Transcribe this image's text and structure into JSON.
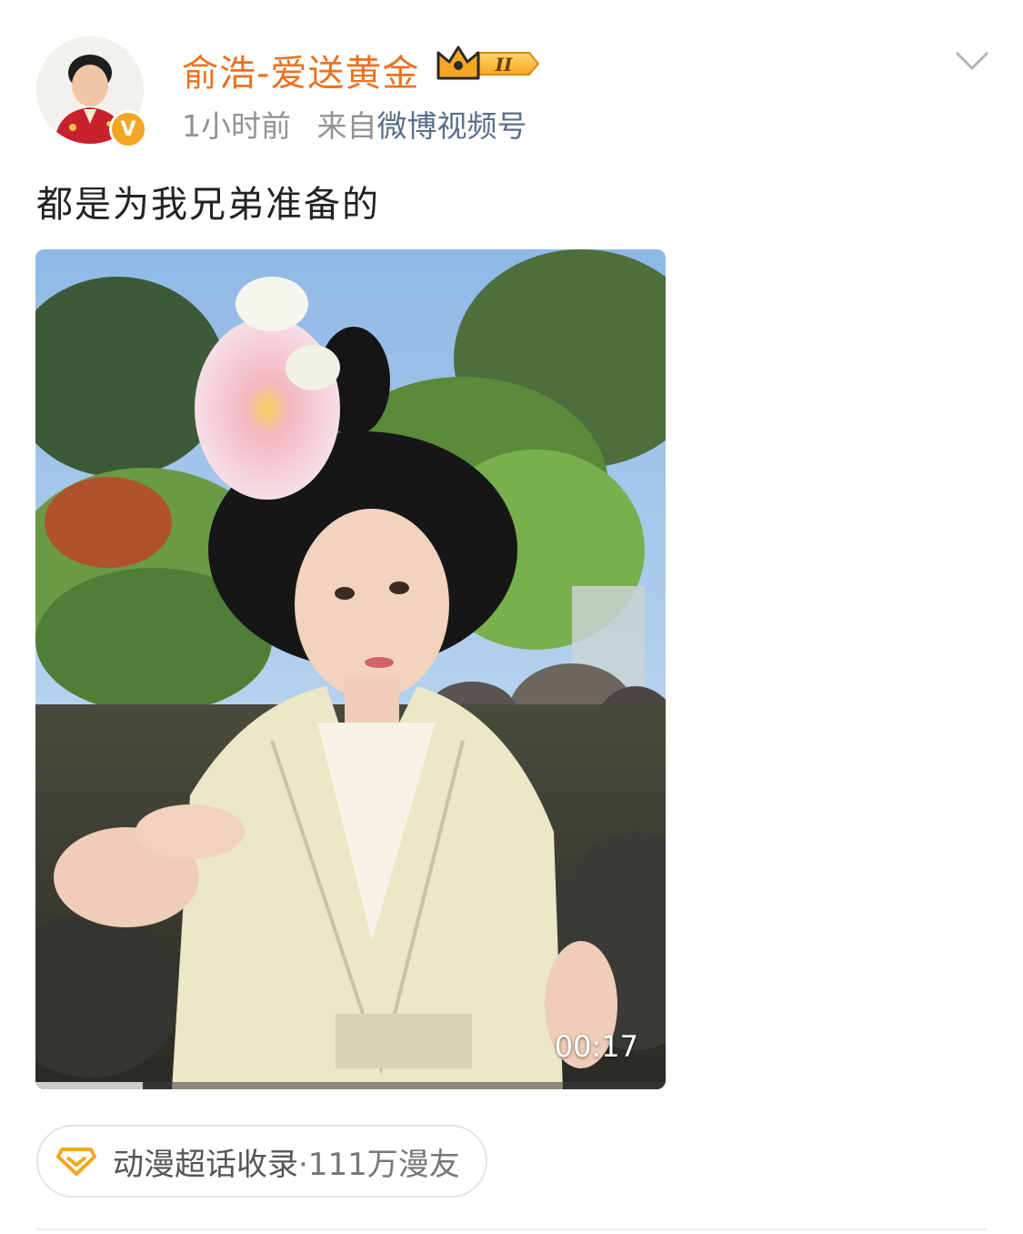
{
  "post": {
    "author": {
      "name": "俞浩-爱送黄金",
      "badge_level": "II",
      "verified_mark": "V"
    },
    "meta": {
      "time": "1小时前",
      "source_prefix": "来自",
      "source": "微博视频号"
    },
    "text": "都是为我兄弟准备的",
    "video": {
      "duration": "00:17",
      "progress": 0.17
    },
    "topic": {
      "label": "动漫超话收录",
      "count": "·111万漫友"
    }
  },
  "colors": {
    "username": "#eb7120",
    "source_link": "#5b6e8c",
    "topic_icon": "#f5a623"
  }
}
